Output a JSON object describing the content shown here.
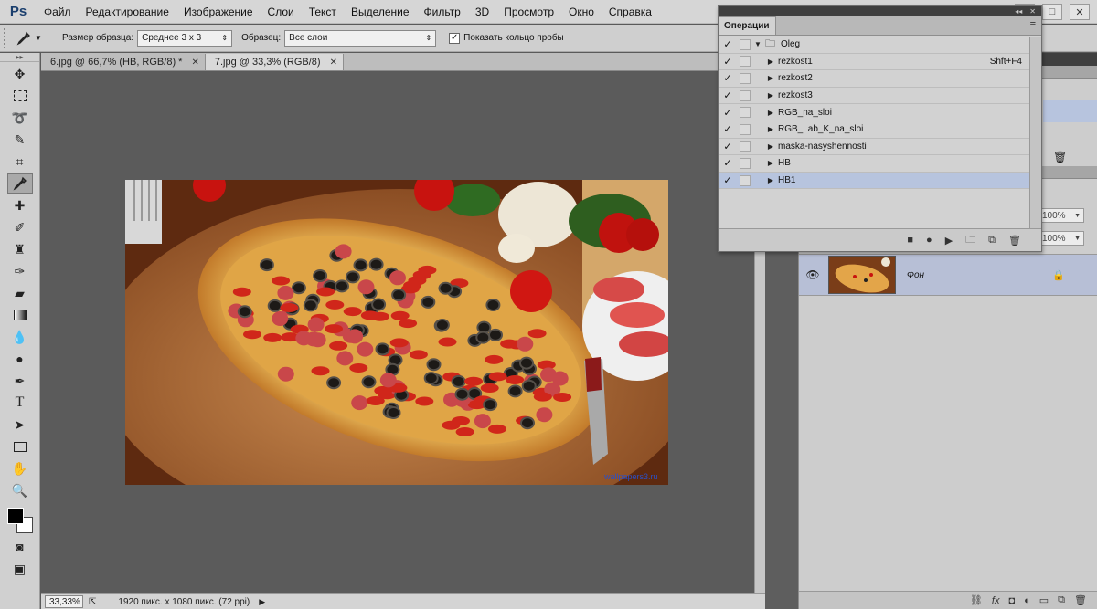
{
  "app": {
    "logo": "Ps"
  },
  "menu": [
    "Файл",
    "Редактирование",
    "Изображение",
    "Слои",
    "Текст",
    "Выделение",
    "Фильтр",
    "3D",
    "Просмотр",
    "Окно",
    "Справка"
  ],
  "options": {
    "sample_size_label": "Размер образца:",
    "sample_size_value": "Среднее 3 х 3",
    "sample_label": "Образец:",
    "sample_value": "Все слои",
    "show_ring_label": "Показать кольцо пробы",
    "show_ring_checked": true
  },
  "doc_tabs": [
    {
      "title": "6.jpg @ 66,7% (НВ, RGB/8) *",
      "active": false
    },
    {
      "title": "7.jpg @ 33,3% (RGB/8)",
      "active": true
    }
  ],
  "status": {
    "zoom": "33,33%",
    "info": "1920 пикс. х 1080 пикс. (72 ppi)"
  },
  "image": {
    "watermark": "wallpapers3.ru"
  },
  "actions_panel": {
    "tab_label": "Операции",
    "rows": [
      {
        "name": "Oleg",
        "folder": true,
        "expanded": true,
        "shortcut": "",
        "selected": false
      },
      {
        "name": "rezkost1",
        "folder": false,
        "expanded": false,
        "shortcut": "Shft+F4",
        "selected": false
      },
      {
        "name": "rezkost2",
        "folder": false,
        "expanded": false,
        "shortcut": "",
        "selected": false
      },
      {
        "name": "rezkost3",
        "folder": false,
        "expanded": false,
        "shortcut": "",
        "selected": false
      },
      {
        "name": "RGB_na_sloi",
        "folder": false,
        "expanded": false,
        "shortcut": "",
        "selected": false
      },
      {
        "name": "RGB_Lab_K_na_sloi",
        "folder": false,
        "expanded": false,
        "shortcut": "",
        "selected": false
      },
      {
        "name": "maska-nasyshennosti",
        "folder": false,
        "expanded": false,
        "shortcut": "",
        "selected": false
      },
      {
        "name": "HB",
        "folder": false,
        "expanded": false,
        "shortcut": "",
        "selected": false
      },
      {
        "name": "HB1",
        "folder": false,
        "expanded": false,
        "shortcut": "",
        "selected": true
      }
    ]
  },
  "layers_panel": {
    "opacity": "100%",
    "fill": "100%",
    "layer_name": "Фон"
  },
  "colors": {
    "selection": "#b7c4de",
    "canvas_bg": "#5b5b5b"
  }
}
